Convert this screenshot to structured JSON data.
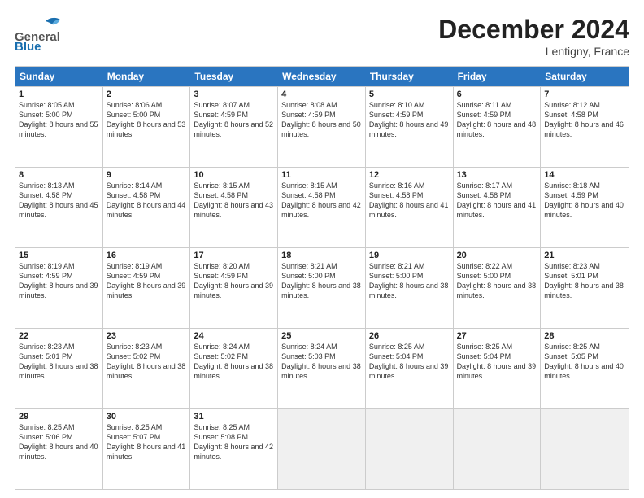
{
  "header": {
    "month_title": "December 2024",
    "location": "Lentigny, France",
    "logo_general": "General",
    "logo_blue": "Blue"
  },
  "weekdays": [
    "Sunday",
    "Monday",
    "Tuesday",
    "Wednesday",
    "Thursday",
    "Friday",
    "Saturday"
  ],
  "weeks": [
    [
      {
        "day": "1",
        "sunrise": "8:05 AM",
        "sunset": "5:00 PM",
        "daylight": "8 hours and 55 minutes."
      },
      {
        "day": "2",
        "sunrise": "8:06 AM",
        "sunset": "5:00 PM",
        "daylight": "8 hours and 53 minutes."
      },
      {
        "day": "3",
        "sunrise": "8:07 AM",
        "sunset": "4:59 PM",
        "daylight": "8 hours and 52 minutes."
      },
      {
        "day": "4",
        "sunrise": "8:08 AM",
        "sunset": "4:59 PM",
        "daylight": "8 hours and 50 minutes."
      },
      {
        "day": "5",
        "sunrise": "8:10 AM",
        "sunset": "4:59 PM",
        "daylight": "8 hours and 49 minutes."
      },
      {
        "day": "6",
        "sunrise": "8:11 AM",
        "sunset": "4:59 PM",
        "daylight": "8 hours and 48 minutes."
      },
      {
        "day": "7",
        "sunrise": "8:12 AM",
        "sunset": "4:58 PM",
        "daylight": "8 hours and 46 minutes."
      }
    ],
    [
      {
        "day": "8",
        "sunrise": "8:13 AM",
        "sunset": "4:58 PM",
        "daylight": "8 hours and 45 minutes."
      },
      {
        "day": "9",
        "sunrise": "8:14 AM",
        "sunset": "4:58 PM",
        "daylight": "8 hours and 44 minutes."
      },
      {
        "day": "10",
        "sunrise": "8:15 AM",
        "sunset": "4:58 PM",
        "daylight": "8 hours and 43 minutes."
      },
      {
        "day": "11",
        "sunrise": "8:15 AM",
        "sunset": "4:58 PM",
        "daylight": "8 hours and 42 minutes."
      },
      {
        "day": "12",
        "sunrise": "8:16 AM",
        "sunset": "4:58 PM",
        "daylight": "8 hours and 41 minutes."
      },
      {
        "day": "13",
        "sunrise": "8:17 AM",
        "sunset": "4:58 PM",
        "daylight": "8 hours and 41 minutes."
      },
      {
        "day": "14",
        "sunrise": "8:18 AM",
        "sunset": "4:59 PM",
        "daylight": "8 hours and 40 minutes."
      }
    ],
    [
      {
        "day": "15",
        "sunrise": "8:19 AM",
        "sunset": "4:59 PM",
        "daylight": "8 hours and 39 minutes."
      },
      {
        "day": "16",
        "sunrise": "8:19 AM",
        "sunset": "4:59 PM",
        "daylight": "8 hours and 39 minutes."
      },
      {
        "day": "17",
        "sunrise": "8:20 AM",
        "sunset": "4:59 PM",
        "daylight": "8 hours and 39 minutes."
      },
      {
        "day": "18",
        "sunrise": "8:21 AM",
        "sunset": "5:00 PM",
        "daylight": "8 hours and 38 minutes."
      },
      {
        "day": "19",
        "sunrise": "8:21 AM",
        "sunset": "5:00 PM",
        "daylight": "8 hours and 38 minutes."
      },
      {
        "day": "20",
        "sunrise": "8:22 AM",
        "sunset": "5:00 PM",
        "daylight": "8 hours and 38 minutes."
      },
      {
        "day": "21",
        "sunrise": "8:23 AM",
        "sunset": "5:01 PM",
        "daylight": "8 hours and 38 minutes."
      }
    ],
    [
      {
        "day": "22",
        "sunrise": "8:23 AM",
        "sunset": "5:01 PM",
        "daylight": "8 hours and 38 minutes."
      },
      {
        "day": "23",
        "sunrise": "8:23 AM",
        "sunset": "5:02 PM",
        "daylight": "8 hours and 38 minutes."
      },
      {
        "day": "24",
        "sunrise": "8:24 AM",
        "sunset": "5:02 PM",
        "daylight": "8 hours and 38 minutes."
      },
      {
        "day": "25",
        "sunrise": "8:24 AM",
        "sunset": "5:03 PM",
        "daylight": "8 hours and 38 minutes."
      },
      {
        "day": "26",
        "sunrise": "8:25 AM",
        "sunset": "5:04 PM",
        "daylight": "8 hours and 39 minutes."
      },
      {
        "day": "27",
        "sunrise": "8:25 AM",
        "sunset": "5:04 PM",
        "daylight": "8 hours and 39 minutes."
      },
      {
        "day": "28",
        "sunrise": "8:25 AM",
        "sunset": "5:05 PM",
        "daylight": "8 hours and 40 minutes."
      }
    ],
    [
      {
        "day": "29",
        "sunrise": "8:25 AM",
        "sunset": "5:06 PM",
        "daylight": "8 hours and 40 minutes."
      },
      {
        "day": "30",
        "sunrise": "8:25 AM",
        "sunset": "5:07 PM",
        "daylight": "8 hours and 41 minutes."
      },
      {
        "day": "31",
        "sunrise": "8:25 AM",
        "sunset": "5:08 PM",
        "daylight": "8 hours and 42 minutes."
      },
      null,
      null,
      null,
      null
    ]
  ],
  "labels": {
    "sunrise": "Sunrise:",
    "sunset": "Sunset:",
    "daylight": "Daylight:"
  }
}
